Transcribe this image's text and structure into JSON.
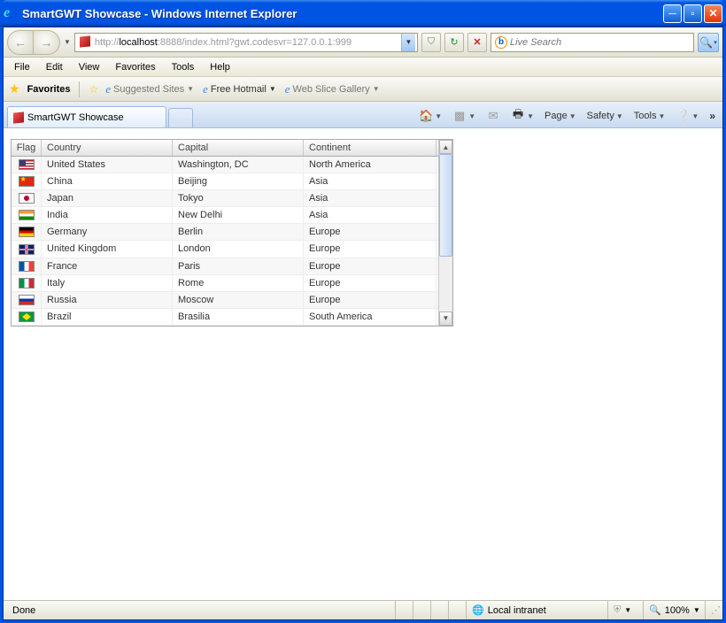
{
  "window": {
    "title": "SmartGWT Showcase - Windows Internet Explorer"
  },
  "nav": {
    "url_proto": "http://",
    "url_host": "localhost",
    "url_rest": ":8888/index.html?gwt.codesvr=127.0.0.1:999",
    "search_placeholder": "Live Search"
  },
  "menu": {
    "items": [
      "File",
      "Edit",
      "View",
      "Favorites",
      "Tools",
      "Help"
    ]
  },
  "favbar": {
    "label": "Favorites",
    "links": [
      {
        "text": "Suggested Sites",
        "dropdown": true
      },
      {
        "text": "Free Hotmail",
        "dropdown": true,
        "dark": true
      },
      {
        "text": "Web Slice Gallery",
        "dropdown": true
      }
    ]
  },
  "tab": {
    "title": "SmartGWT Showcase"
  },
  "cmdbar": {
    "page": "Page",
    "safety": "Safety",
    "tools": "Tools"
  },
  "grid": {
    "columns": [
      "Flag",
      "Country",
      "Capital",
      "Continent"
    ],
    "rows": [
      {
        "flag": "f-us",
        "country": "United States",
        "capital": "Washington, DC",
        "continent": "North America"
      },
      {
        "flag": "f-cn",
        "country": "China",
        "capital": "Beijing",
        "continent": "Asia"
      },
      {
        "flag": "f-jp",
        "country": "Japan",
        "capital": "Tokyo",
        "continent": "Asia"
      },
      {
        "flag": "f-in",
        "country": "India",
        "capital": "New Delhi",
        "continent": "Asia"
      },
      {
        "flag": "f-de",
        "country": "Germany",
        "capital": "Berlin",
        "continent": "Europe"
      },
      {
        "flag": "f-gb",
        "country": "United Kingdom",
        "capital": "London",
        "continent": "Europe"
      },
      {
        "flag": "f-fr",
        "country": "France",
        "capital": "Paris",
        "continent": "Europe"
      },
      {
        "flag": "f-it",
        "country": "Italy",
        "capital": "Rome",
        "continent": "Europe"
      },
      {
        "flag": "f-ru",
        "country": "Russia",
        "capital": "Moscow",
        "continent": "Europe"
      },
      {
        "flag": "f-br",
        "country": "Brazil",
        "capital": "Brasilia",
        "continent": "South America"
      }
    ]
  },
  "status": {
    "left": "Done",
    "zone": "Local intranet",
    "zoom": "100%"
  }
}
